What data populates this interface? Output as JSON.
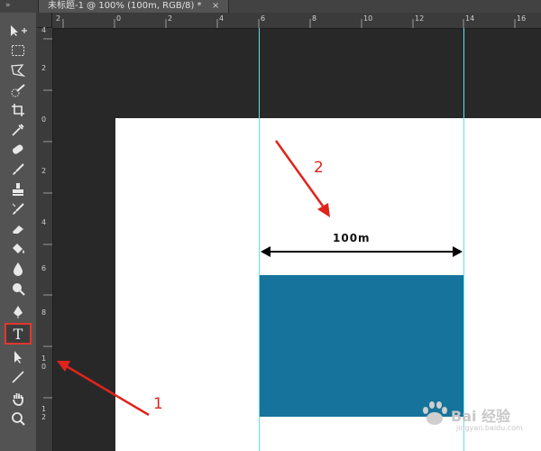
{
  "tabbar": {
    "title": "未标题-1 @ 100% (100m, RGB/8) *",
    "close": "×",
    "grip": "»"
  },
  "ruler_h": [
    "2",
    "0",
    "2",
    "4",
    "6",
    "8",
    "10",
    "12",
    "14",
    "16"
  ],
  "ruler_v": [
    "4",
    "2",
    "0",
    "2",
    "4",
    "6",
    "8",
    "1\n0",
    "1\n2"
  ],
  "canvas": {
    "measure_label": "100m"
  },
  "annotations": {
    "one": "1",
    "two": "2"
  },
  "tools": [
    "move",
    "marquee",
    "lasso",
    "quick-select",
    "crop",
    "eyedropper",
    "healing",
    "brush",
    "clone-stamp",
    "history-brush",
    "eraser",
    "paint-bucket",
    "blur",
    "dodge",
    "pen",
    "type",
    "path-select",
    "line",
    "hand",
    "zoom"
  ],
  "active_tool": "type",
  "active_tool_glyph": "T",
  "watermark": {
    "brand": "Bai 经验",
    "sub": "jingyan.baidu.com"
  },
  "colors": {
    "accent": "#e2382e",
    "guide": "#5fe0ec",
    "rectangle": "#16739c",
    "arrow": "#e0241b"
  }
}
